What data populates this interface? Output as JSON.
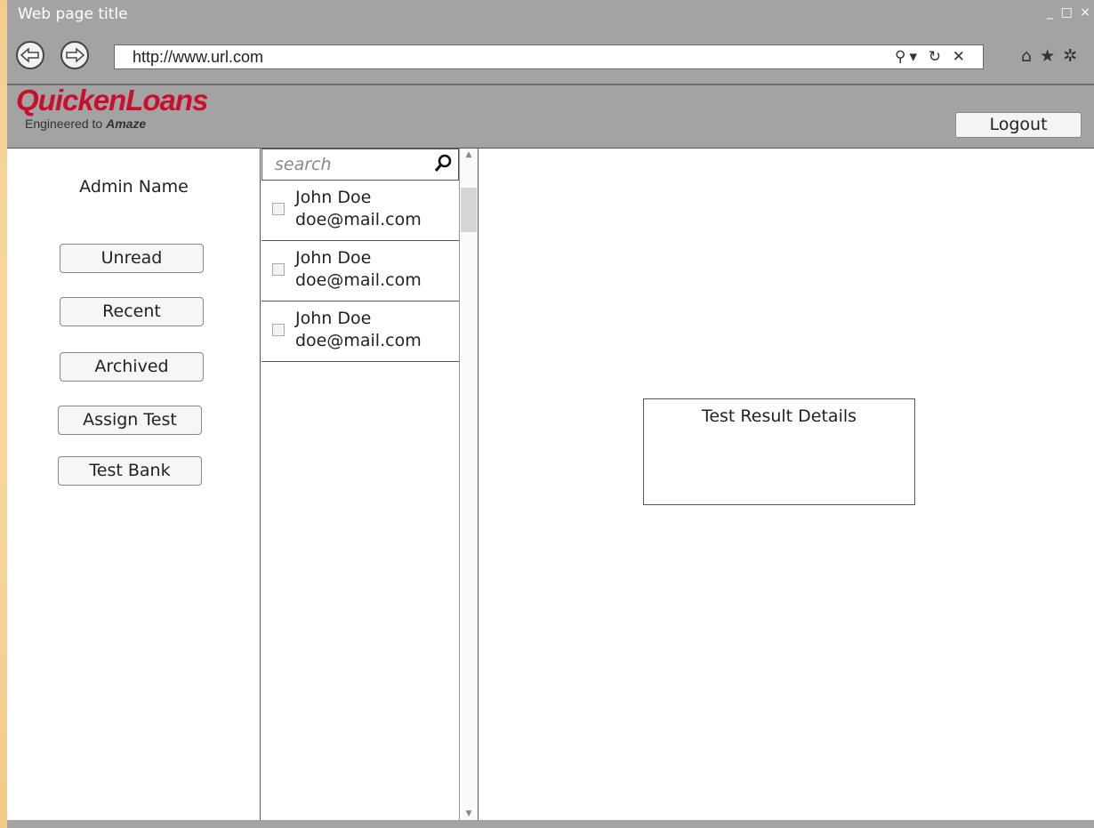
{
  "browser": {
    "window_title": "Web page title",
    "url": "http://www.url.com",
    "win_controls": [
      "_",
      "□",
      "×"
    ],
    "url_icons": [
      "search-dropdown-icon",
      "refresh-icon",
      "close-icon"
    ],
    "toolbar_icons": [
      "home-icon",
      "star-icon",
      "gear-icon"
    ]
  },
  "header": {
    "logo_brand": "QuickenLoans",
    "logo_tagline_prefix": "Engineered to",
    "logo_tagline_emphasis": "Amaze",
    "logout_label": "Logout"
  },
  "sidebar": {
    "admin_name": "Admin Name",
    "buttons": [
      {
        "label": "Unread"
      },
      {
        "label": "Recent"
      },
      {
        "label": "Archived"
      },
      {
        "label": "Assign Test"
      },
      {
        "label": "Test Bank"
      }
    ]
  },
  "list": {
    "search_placeholder": "search",
    "items": [
      {
        "name": "John Doe",
        "email": "doe@mail.com"
      },
      {
        "name": "John Doe",
        "email": "doe@mail.com"
      },
      {
        "name": "John Doe",
        "email": "doe@mail.com"
      }
    ]
  },
  "details": {
    "title": "Test Result Details"
  },
  "colors": {
    "brand_red": "#c8102e",
    "chrome_gray": "#a3a3a3",
    "background_warm": "#fbe2b0"
  }
}
